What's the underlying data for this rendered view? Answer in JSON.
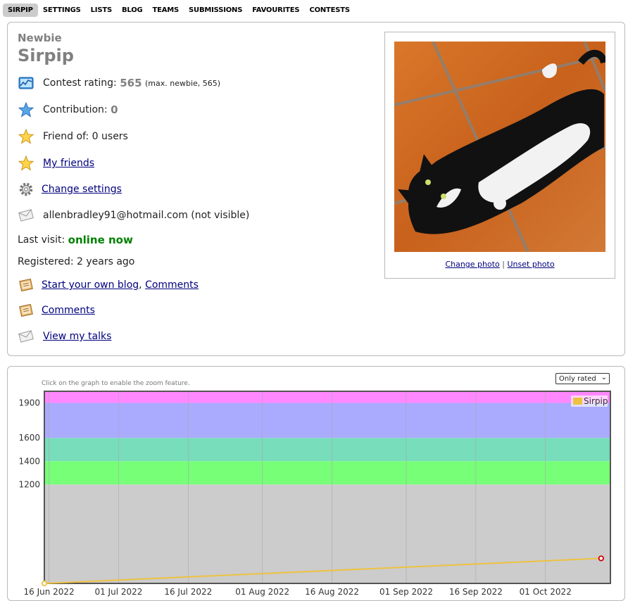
{
  "nav": {
    "tabs": [
      "SIRPIP",
      "SETTINGS",
      "LISTS",
      "BLOG",
      "TEAMS",
      "SUBMISSIONS",
      "FAVOURITES",
      "CONTESTS"
    ],
    "active_tab": "SIRPIP"
  },
  "profile": {
    "rank": "Newbie",
    "handle": "Sirpip",
    "contest_rating_label": "Contest rating:",
    "contest_rating": "565",
    "max_rating_text": "(max. newbie, 565)",
    "contribution_label": "Contribution:",
    "contribution": "0",
    "friend_of": "Friend of: 0 users",
    "my_friends_link": "My friends",
    "change_settings_link": "Change settings",
    "email": "allenbradley91@hotmail.com (not visible)",
    "last_visit_label": "Last visit:",
    "last_visit": "online now",
    "registered": "Registered: 2 years ago",
    "blog_link": "Start your own blog",
    "comma": ",",
    "comments_link_1": "Comments",
    "comments_link_2": "Comments",
    "talks_link": "View my talks",
    "change_photo_link": "Change photo",
    "separator": "|",
    "unset_photo_link": "Unset photo"
  },
  "graph": {
    "zoom_hint": "Click on the graph to enable the zoom feature.",
    "filter_select": "Only rated",
    "colors": {
      "gray": "#cccccc",
      "green": "#77ff77",
      "cyan": "#77ddbb",
      "blue": "#aaaaff",
      "violet": "#ff88ff",
      "line": "#edc240",
      "last_point": "#cc0000"
    }
  },
  "chart_data": {
    "type": "line",
    "x_ticks": [
      "16 Jun 2022",
      "01 Jul 2022",
      "16 Jul 2022",
      "01 Aug 2022",
      "16 Aug 2022",
      "01 Sep 2022",
      "16 Sep 2022",
      "01 Oct 2022"
    ],
    "y_ticks": [
      1200,
      1400,
      1600,
      1900
    ],
    "ylim": [
      350,
      2000
    ],
    "rating_bands": [
      {
        "from": 0,
        "to": 1200,
        "color": "#cccccc"
      },
      {
        "from": 1200,
        "to": 1400,
        "color": "#77ff77"
      },
      {
        "from": 1400,
        "to": 1600,
        "color": "#77ddbb"
      },
      {
        "from": 1600,
        "to": 1900,
        "color": "#aaaaff"
      },
      {
        "from": 1900,
        "to": 2100,
        "color": "#ff88ff"
      }
    ],
    "series": [
      {
        "name": "Sirpip",
        "points": [
          {
            "x": "15 Jun 2022",
            "y": 350
          },
          {
            "x": "13 Oct 2022",
            "y": 565
          }
        ]
      }
    ],
    "legend": "top-right"
  }
}
